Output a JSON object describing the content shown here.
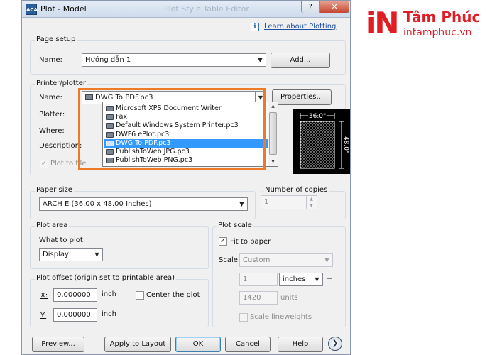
{
  "window": {
    "app_icon_text": "ACA",
    "title": "Plot - Model",
    "faded_title": "Plot Style Table Editor",
    "help_btn": "?",
    "close_btn": "✕"
  },
  "learn_link": {
    "icon": "i",
    "text": "Learn about Plotting"
  },
  "page_setup": {
    "group_label": "Page setup",
    "name_label": "Name:",
    "name_value": "Hướng dẫn 1",
    "add_button": "Add..."
  },
  "printer": {
    "group_label": "Printer/plotter",
    "name_label": "Name:",
    "selected": "DWG To PDF.pc3",
    "properties_button": "Properties...",
    "plotter_label": "Plotter:",
    "where_label": "Where:",
    "description_label": "Description:",
    "plot_to_file": "Plot to file",
    "options": [
      {
        "label": "Microsoft XPS Document Writer",
        "selected": false
      },
      {
        "label": "Fax",
        "selected": false
      },
      {
        "label": "Default Windows System Printer.pc3",
        "selected": false
      },
      {
        "label": "DWF6 ePlot.pc3",
        "selected": false
      },
      {
        "label": "DWG To PDF.pc3",
        "selected": true
      },
      {
        "label": "PublishToWeb JPG.pc3",
        "selected": false
      },
      {
        "label": "PublishToWeb PNG.pc3",
        "selected": false
      }
    ],
    "preview": {
      "width_text": "36.0\"",
      "height_text": "48.0\""
    }
  },
  "paper_size": {
    "group_label": "Paper size",
    "value": "ARCH E (36.00 x 48.00 Inches)"
  },
  "copies": {
    "group_label": "Number of copies",
    "value": "1"
  },
  "plot_area": {
    "group_label": "Plot area",
    "what_label": "What to plot:",
    "value": "Display"
  },
  "plot_offset": {
    "group_label": "Plot offset (origin set to printable area)",
    "x_label": "X:",
    "x_value": "0.000000",
    "y_label": "Y:",
    "y_value": "0.000000",
    "unit": "inch",
    "center_label": "Center the plot"
  },
  "plot_scale": {
    "group_label": "Plot scale",
    "fit_label": "Fit to paper",
    "scale_label": "Scale:",
    "scale_value": "Custom",
    "value1": "1",
    "unit1": "inches",
    "eq": "=",
    "value2": "1420",
    "unit2": "units",
    "lineweights_label": "Scale lineweights"
  },
  "footer": {
    "preview_button": "Preview...",
    "apply_button": "Apply to Layout",
    "ok_button": "OK",
    "cancel_button": "Cancel",
    "help_button": "Help",
    "expand_button": "❯"
  },
  "logo": {
    "mark": "iN",
    "name": "Tâm Phúc",
    "url": "intamphuc.vn"
  },
  "colors": {
    "highlight": "#ec7a26",
    "selection": "#3399ff",
    "logo_red": "#e01d24"
  }
}
